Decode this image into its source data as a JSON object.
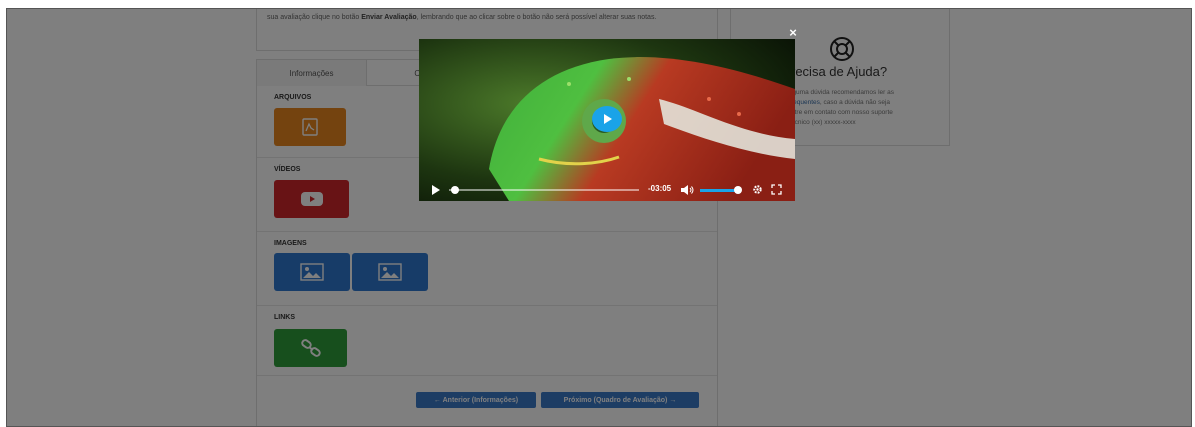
{
  "instructions": {
    "text_before": "sua avaliação clique no botão ",
    "bold": "Enviar Avaliação",
    "text_after": ", lembrando que ao clicar sobre o botão não será possível alterar suas notas."
  },
  "tabs": [
    {
      "label": "Informações"
    },
    {
      "label": "Conte"
    }
  ],
  "sections": {
    "arquivos": {
      "title": "ARQUIVOS",
      "color": "#e8861e"
    },
    "videos": {
      "title": "VÍDEOS",
      "color": "#d0272b"
    },
    "imagens": {
      "title": "IMAGENS",
      "color": "#2f78d0"
    },
    "links": {
      "title": "LINKS",
      "color": "#2e9e3a"
    }
  },
  "nav": {
    "prev_label": "← Anterior (Informações)",
    "next_label": "Próximo (Quadro de Avaliação) →"
  },
  "help": {
    "title": "recisa de Ajuda?",
    "line1": "lguma dúvida recomendamos ler as",
    "link": "requentes",
    "line2": ", caso a dúvida não seja",
    "line3": "ntre em contato com nosso suporte",
    "line4": "écnico (xx) xxxxx-xxxx"
  },
  "modal": {
    "close_label": "×",
    "time_remaining": "-03:05",
    "progress": 0.02,
    "volume": 0.95,
    "accent_color": "#1aa3e8"
  }
}
